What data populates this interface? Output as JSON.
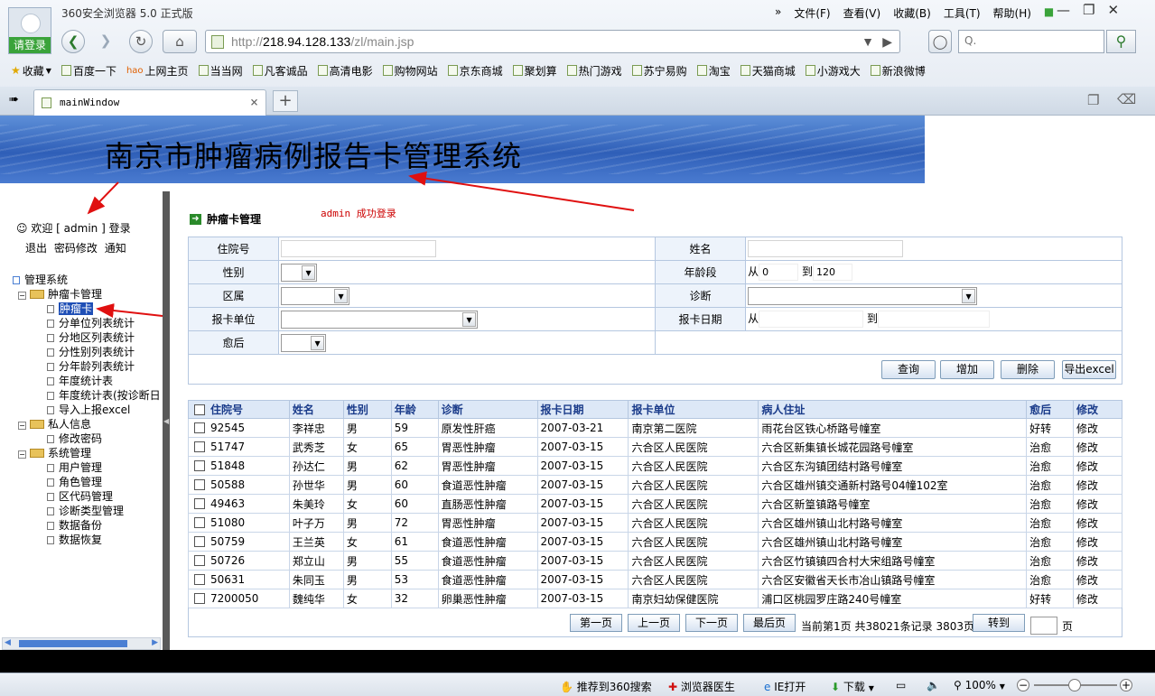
{
  "browser": {
    "window_title": "360安全浏览器 5.0 正式版",
    "login_label": "请登录",
    "menu": [
      "文件(F)",
      "查看(V)",
      "收藏(B)",
      "工具(T)",
      "帮助(H)"
    ],
    "menu_overflow": "»",
    "url_prefix": "http://",
    "url_host": "218.94.128.133",
    "url_path": "/zl/main.jsp",
    "search_placeholder": "Q.",
    "favorites_label": "收藏",
    "favorites": [
      "百度一下",
      "上网主页",
      "当当网",
      "凡客诚品",
      "高清电影",
      "购物网站",
      "京东商城",
      "聚划算",
      "热门游戏",
      "苏宁易购",
      "淘宝",
      "天猫商城",
      "小游戏大",
      "新浪微博"
    ],
    "tab_title": "mainWindow",
    "tab_close": "×",
    "new_tab": "+"
  },
  "banner": {
    "title": "南京市肿瘤病例报告卡管理系统"
  },
  "sidebar": {
    "welcome": "欢迎 [ admin ] 登录",
    "links": [
      "退出",
      "密码修改",
      "通知"
    ],
    "tree": [
      {
        "label": "管理系统",
        "level": 0,
        "type": "root"
      },
      {
        "label": "肿瘤卡管理",
        "level": 1,
        "type": "folder"
      },
      {
        "label": "肿瘤卡",
        "level": 2,
        "type": "leaf",
        "selected": true
      },
      {
        "label": "分单位列表统计",
        "level": 2,
        "type": "leaf"
      },
      {
        "label": "分地区列表统计",
        "level": 2,
        "type": "leaf"
      },
      {
        "label": "分性别列表统计",
        "level": 2,
        "type": "leaf"
      },
      {
        "label": "分年龄列表统计",
        "level": 2,
        "type": "leaf"
      },
      {
        "label": "年度统计表",
        "level": 2,
        "type": "leaf"
      },
      {
        "label": "年度统计表(按诊断日",
        "level": 2,
        "type": "leaf"
      },
      {
        "label": "导入上报excel",
        "level": 2,
        "type": "leaf"
      },
      {
        "label": "私人信息",
        "level": 1,
        "type": "folder"
      },
      {
        "label": "修改密码",
        "level": 2,
        "type": "leaf"
      },
      {
        "label": "系统管理",
        "level": 1,
        "type": "folder"
      },
      {
        "label": "用户管理",
        "level": 2,
        "type": "leaf"
      },
      {
        "label": "角色管理",
        "level": 2,
        "type": "leaf"
      },
      {
        "label": "区代码管理",
        "level": 2,
        "type": "leaf"
      },
      {
        "label": "诊断类型管理",
        "level": 2,
        "type": "leaf"
      },
      {
        "label": "数据备份",
        "level": 2,
        "type": "leaf"
      },
      {
        "label": "数据恢复",
        "level": 2,
        "type": "leaf"
      }
    ]
  },
  "main": {
    "page_title": "肿瘤卡管理",
    "login_msg": "admin 成功登录",
    "form": {
      "inpatient_no": "住院号",
      "name": "姓名",
      "gender": "性别",
      "age_range": "年龄段",
      "age_from_label": "从",
      "age_from": "0",
      "age_to_label": "到",
      "age_to": "120",
      "district": "区属",
      "diagnosis": "诊断",
      "report_unit": "报卡单位",
      "report_date": "报卡日期",
      "date_from_label": "从",
      "date_to_label": "到",
      "outcome": "愈后"
    },
    "buttons": {
      "query": "查询",
      "add": "增加",
      "delete": "删除",
      "export": "导出excel"
    },
    "columns": [
      "住院号",
      "姓名",
      "性别",
      "年龄",
      "诊断",
      "报卡日期",
      "报卡单位",
      "病人住址",
      "愈后",
      "修改"
    ],
    "rows": [
      [
        "92545",
        "李祥忠",
        "男",
        "59",
        "原发性肝癌",
        "2007-03-21",
        "南京第二医院",
        "雨花台区铁心桥路号幢室",
        "好转",
        "修改"
      ],
      [
        "51747",
        "武秀芝",
        "女",
        "65",
        "胃恶性肿瘤",
        "2007-03-15",
        "六合区人民医院",
        "六合区新集镇长城花园路号幢室",
        "治愈",
        "修改"
      ],
      [
        "51848",
        "孙达仁",
        "男",
        "62",
        "胃恶性肿瘤",
        "2007-03-15",
        "六合区人民医院",
        "六合区东沟镇团结村路号幢室",
        "治愈",
        "修改"
      ],
      [
        "50588",
        "孙世华",
        "男",
        "60",
        "食道恶性肿瘤",
        "2007-03-15",
        "六合区人民医院",
        "六合区雄州镇交通新村路号04幢102室",
        "治愈",
        "修改"
      ],
      [
        "49463",
        "朱美玲",
        "女",
        "60",
        "直肠恶性肿瘤",
        "2007-03-15",
        "六合区人民医院",
        "六合区新篁镇路号幢室",
        "治愈",
        "修改"
      ],
      [
        "51080",
        "叶子万",
        "男",
        "72",
        "胃恶性肿瘤",
        "2007-03-15",
        "六合区人民医院",
        "六合区雄州镇山北村路号幢室",
        "治愈",
        "修改"
      ],
      [
        "50759",
        "王兰英",
        "女",
        "61",
        "食道恶性肿瘤",
        "2007-03-15",
        "六合区人民医院",
        "六合区雄州镇山北村路号幢室",
        "治愈",
        "修改"
      ],
      [
        "50726",
        "郑立山",
        "男",
        "55",
        "食道恶性肿瘤",
        "2007-03-15",
        "六合区人民医院",
        "六合区竹镇镇四合村大宋组路号幢室",
        "治愈",
        "修改"
      ],
      [
        "50631",
        "朱同玉",
        "男",
        "53",
        "食道恶性肿瘤",
        "2007-03-15",
        "六合区人民医院",
        "六合区安徽省天长市冶山镇路号幢室",
        "治愈",
        "修改"
      ],
      [
        "7200050",
        "魏纯华",
        "女",
        "32",
        "卵巢恶性肿瘤",
        "2007-03-15",
        "南京妇幼保健医院",
        "浦口区桃园罗庄路240号幢室",
        "好转",
        "修改"
      ]
    ],
    "pager": {
      "first": "第一页",
      "prev": "上一页",
      "next": "下一页",
      "last": "最后页",
      "info": "当前第1页 共38021条记录 3803页",
      "goto": "转到",
      "page_word": "页"
    }
  },
  "footer": {
    "recommend": "推荐到360搜索",
    "doctor": "浏览器医生",
    "ie_open": "IE打开",
    "download": "下载",
    "zoom": "100%"
  }
}
